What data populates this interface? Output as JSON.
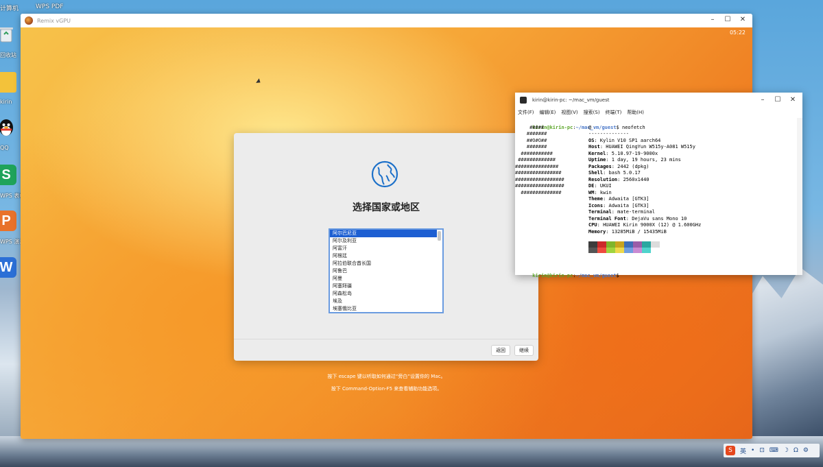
{
  "desktop": {
    "top_labels": [
      "计算机",
      "WPS PDF"
    ],
    "icons": [
      {
        "label": "回收站",
        "icon": "trash-icon"
      },
      {
        "label": "kirin",
        "icon": "folder-icon"
      },
      {
        "label": "QQ",
        "icon": "qq-icon"
      },
      {
        "label": "WPS 表格",
        "icon": "wps-sheet-icon",
        "glyph": "S"
      },
      {
        "label": "WPS 演示",
        "icon": "wps-ppt-icon",
        "glyph": "P"
      },
      {
        "label": "",
        "icon": "wps-writer-icon",
        "glyph": "W"
      }
    ]
  },
  "vm_window": {
    "title": "Remix vGPU",
    "clock": "05:22",
    "setup": {
      "title": "选择国家或地区",
      "countries": [
        "阿尔巴尼亚",
        "阿尔及利亚",
        "阿富汗",
        "阿根廷",
        "阿拉伯联合酋长国",
        "阿鲁巴",
        "阿曼",
        "阿塞拜疆",
        "阿森松岛",
        "埃及",
        "埃塞俄比亚"
      ],
      "selected_index": 0,
      "back_label": "返回",
      "continue_label": "继续"
    },
    "hints": [
      "按下 escape 键以听取如何通过“旁白”设置你的 Mac。",
      "按下 Command-Option-F5 来查看辅助功能选项。"
    ]
  },
  "terminal": {
    "title": "kirin@kirin-pc: ~/mac_vm/guest",
    "menu": [
      "文件(F)",
      "编辑(E)",
      "视图(V)",
      "搜索(S)",
      "终端(T)",
      "帮助(H)"
    ],
    "prompt_user": "kirin@kirin-pc",
    "prompt_path": "~/mac_vm/guest",
    "command": "neofetch",
    "header_at": "@",
    "separator": "--------------",
    "info": [
      {
        "key": "OS",
        "value": "Kylin V10 SP1 aarch64"
      },
      {
        "key": "Host",
        "value": "HUAWEI QingYun W515y-A081 W515y"
      },
      {
        "key": "Kernel",
        "value": "5.10.97-19-9000x"
      },
      {
        "key": "Uptime",
        "value": "1 day, 19 hours, 23 mins"
      },
      {
        "key": "Packages",
        "value": "2442 (dpkg)"
      },
      {
        "key": "Shell",
        "value": "bash 5.0.17"
      },
      {
        "key": "Resolution",
        "value": "2560x1440"
      },
      {
        "key": "DE",
        "value": "UKUI"
      },
      {
        "key": "WM",
        "value": "kwin"
      },
      {
        "key": "Theme",
        "value": "Adwaita [GTK3]"
      },
      {
        "key": "Icons",
        "value": "Adwaita [GTK3]"
      },
      {
        "key": "Terminal",
        "value": "mate-terminal"
      },
      {
        "key": "Terminal Font",
        "value": "DejaVu sans Mono 10"
      },
      {
        "key": "CPU",
        "value": "HUAWEI Kirin 9000X (12) @ 1.600GHz"
      },
      {
        "key": "Memory",
        "value": "13285MiB / 15435MiB"
      }
    ],
    "ascii_art": [
      "     #####",
      "    #######",
      "    ##O#O##",
      "    #######",
      "  ###########",
      " #############",
      "###############",
      "################",
      "#################",
      "#################",
      "  ##############"
    ],
    "palette_top": [
      "#3c3c3c",
      "#cc2a2a",
      "#7fb52b",
      "#c9a41d",
      "#3e6fb7",
      "#9b5da8",
      "#2aa7a0",
      "#dcdcdc"
    ],
    "palette_bottom": [
      "#555555",
      "#ee4b3f",
      "#9fd43e",
      "#eed84a",
      "#6f9ee0",
      "#c98ad2",
      "#4fd3cc",
      "#ffffff"
    ]
  },
  "tray": {
    "ime_label": "S",
    "lang": "英",
    "items": [
      "•",
      "⊡",
      "⌨",
      "☽",
      "Ω",
      "⚙"
    ]
  }
}
